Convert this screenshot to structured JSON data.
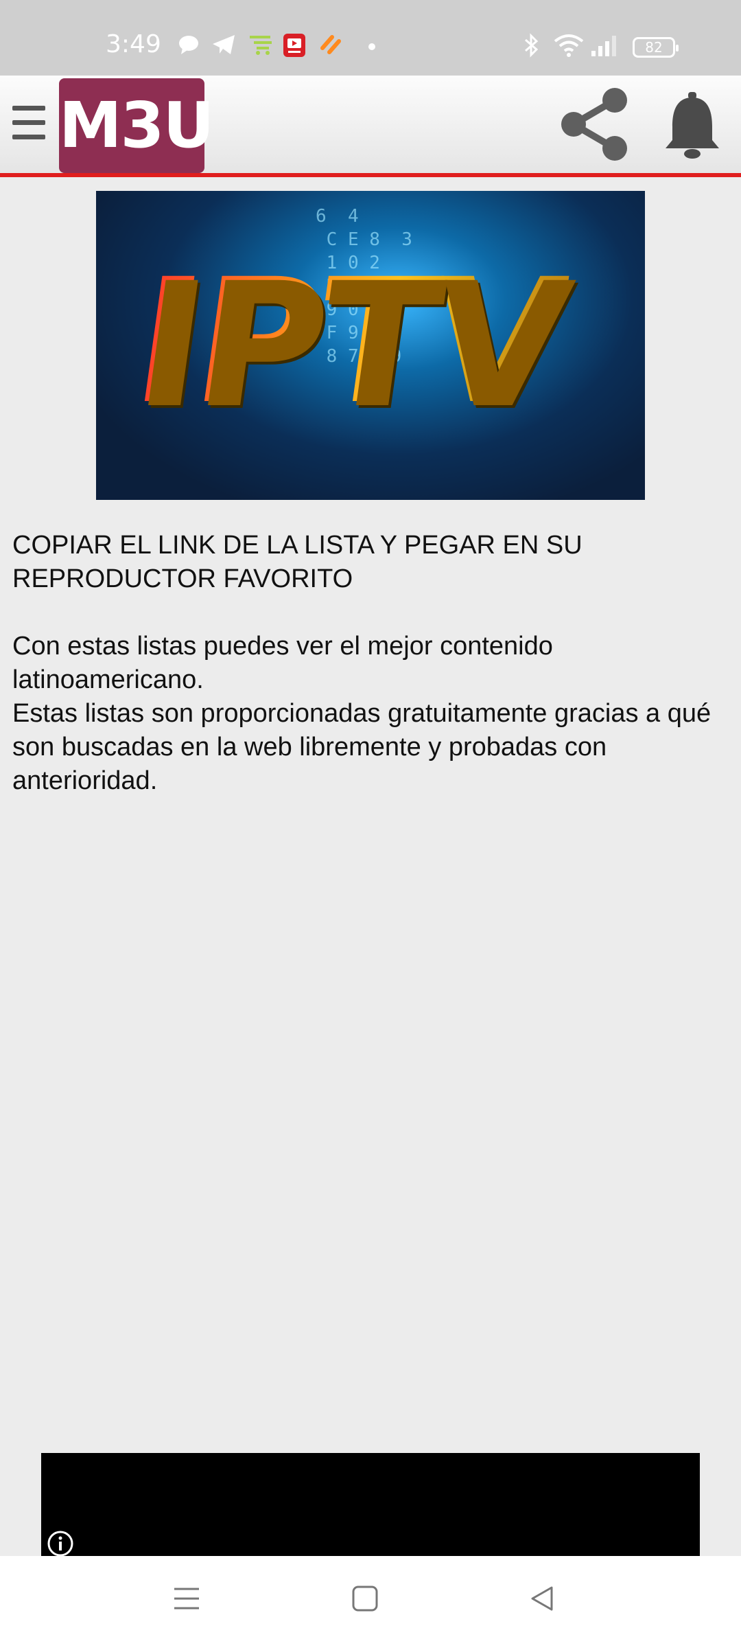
{
  "status_bar": {
    "time": "3:49",
    "battery": "82",
    "icons": [
      "chat-icon",
      "telegram-icon",
      "cart-icon",
      "tv-app-icon",
      "orange-app-icon",
      "dot-icon",
      "bluetooth-icon",
      "wifi-icon",
      "signal-icon",
      "battery-icon"
    ]
  },
  "header": {
    "logo_text": "M3U",
    "accent_color": "#e01e1e",
    "logo_color": "#8e2e52"
  },
  "hero": {
    "title": "IPTV",
    "background_digits": "6  4\n C E 8  3\n 1 0 2\n B 8 4 D\n 9 0 D\n F 9 C 8\n 8 7 E 9"
  },
  "content": {
    "heading_line": "COPIAR EL LINK DE LA LISTA Y PEGAR EN SU REPRODUCTOR FAVORITO",
    "paragraph_1": "Con estas listas puedes ver el mejor contenido latinoamericano.",
    "paragraph_2": "Estas listas son proporcionadas gratuitamente gracias a qué son buscadas en la web libremente y probadas con anterioridad."
  },
  "nav": {
    "icons": [
      "recents-icon",
      "home-icon",
      "back-icon"
    ]
  }
}
